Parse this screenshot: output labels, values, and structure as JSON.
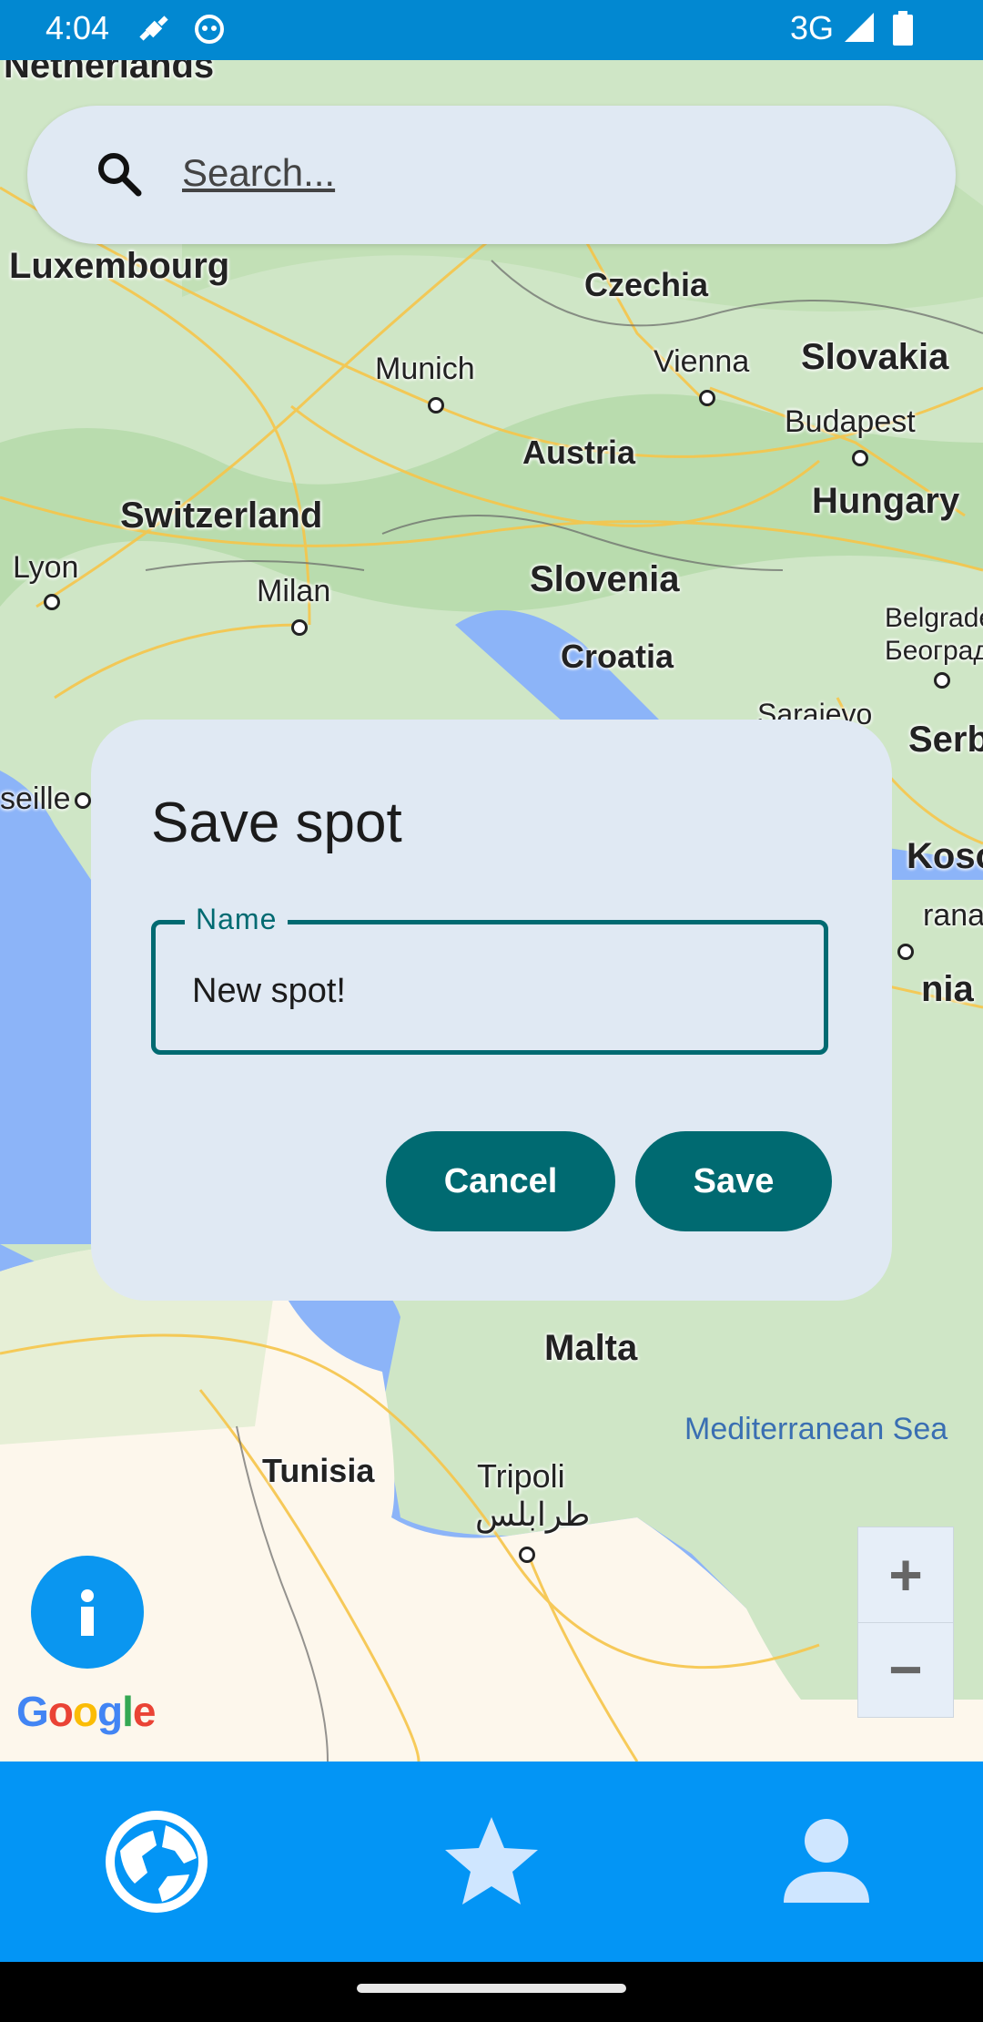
{
  "status_bar": {
    "time": "4:04",
    "network": "3G"
  },
  "search": {
    "placeholder": "Search..."
  },
  "map": {
    "places": [
      {
        "label": "Netherlands",
        "style": "bold"
      },
      {
        "label": "Luxembourg",
        "style": "bold"
      },
      {
        "label": "Czechia",
        "style": "bold"
      },
      {
        "label": "Munich",
        "style": "normal"
      },
      {
        "label": "Vienna",
        "style": "normal"
      },
      {
        "label": "Slovakia",
        "style": "bold"
      },
      {
        "label": "Budapest",
        "style": "normal"
      },
      {
        "label": "Austria",
        "style": "bold"
      },
      {
        "label": "Hungary",
        "style": "bold"
      },
      {
        "label": "Switzerland",
        "style": "bold"
      },
      {
        "label": "Lyon",
        "style": "normal"
      },
      {
        "label": "Milan",
        "style": "normal"
      },
      {
        "label": "Slovenia",
        "style": "bold"
      },
      {
        "label": "Belgrade",
        "style": "normal"
      },
      {
        "label": "Београд",
        "style": "normal"
      },
      {
        "label": "Croatia",
        "style": "bold"
      },
      {
        "label": "Sarajevo",
        "style": "normal"
      },
      {
        "label": "Serb",
        "style": "bold"
      },
      {
        "label": "seille",
        "style": "normal"
      },
      {
        "label": "Koso",
        "style": "bold"
      },
      {
        "label": "rana",
        "style": "normal"
      },
      {
        "label": "nia",
        "style": "bold"
      },
      {
        "label": "Malta",
        "style": "bold"
      },
      {
        "label": "Mediterranean Sea",
        "style": "sea"
      },
      {
        "label": "Tunisia",
        "style": "bold"
      },
      {
        "label": "Tripoli",
        "style": "normal"
      },
      {
        "label": "طرابلس",
        "style": "normal"
      }
    ],
    "zoom_in": "+",
    "zoom_out": "−",
    "attribution": "Google"
  },
  "dialog": {
    "title": "Save spot",
    "field_label": "Name",
    "field_value": "New spot!",
    "cancel_label": "Cancel",
    "save_label": "Save"
  },
  "bottom_nav": {
    "items": [
      {
        "icon": "globe-icon",
        "selected": true
      },
      {
        "icon": "star-icon",
        "selected": false
      },
      {
        "icon": "person-icon",
        "selected": false
      }
    ]
  },
  "colors": {
    "status_bar": "#0288d1",
    "bottom_nav": "#0395f5",
    "accent": "#006a71",
    "dialog_bg": "#e0e9f3",
    "fab": "#0a96f0"
  }
}
